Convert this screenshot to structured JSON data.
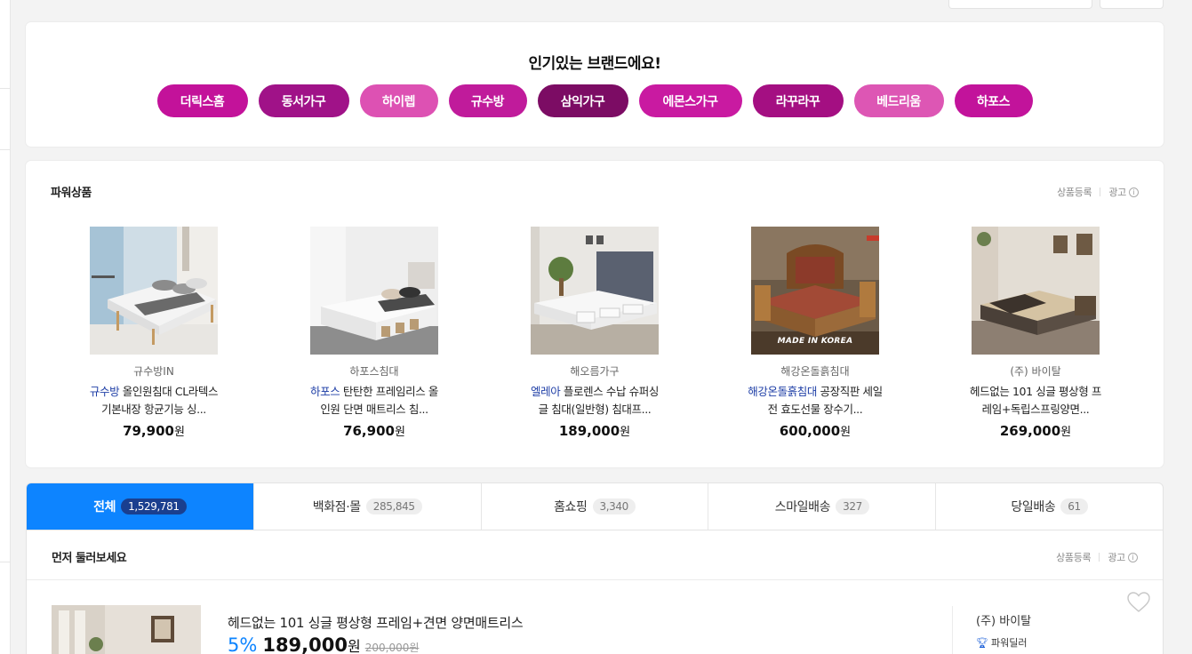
{
  "brands": {
    "title": "인기있는 브랜드에요!",
    "chips": [
      {
        "label": "더릭스홈",
        "color": "#c3129a"
      },
      {
        "label": "동서가구",
        "color": "#a01288"
      },
      {
        "label": "하이렙",
        "color": "#dd51b3"
      },
      {
        "label": "규수방",
        "color": "#c01b9b"
      },
      {
        "label": "삼익가구",
        "color": "#7c0c64"
      },
      {
        "label": "에몬스가구",
        "color": "#c91aa1"
      },
      {
        "label": "라꾸라꾸",
        "color": "#a40f82"
      },
      {
        "label": "베드리움",
        "color": "#dd56b4"
      },
      {
        "label": "하포스",
        "color": "#c2139b"
      }
    ]
  },
  "power": {
    "title": "파워상품",
    "register": "상품등록",
    "ad": "광고",
    "products": [
      {
        "mall": "규수방IN",
        "brand": "규수방",
        "name": " 올인원침대 CL라텍스 기본내장 항균기능 싱...",
        "price": "79,900",
        "won": "원"
      },
      {
        "mall": "하포스침대",
        "brand": "하포스",
        "name": " 탄탄한 프레임리스 올인원 단면 매트리스 침...",
        "price": "76,900",
        "won": "원"
      },
      {
        "mall": "해오름가구",
        "brand": "엘레아",
        "name": " 플로렌스 수납 슈퍼싱글 침대(일반형) 침대프...",
        "price": "189,000",
        "won": "원"
      },
      {
        "mall": "해강온돌흙침대",
        "brand": "해강온돌흙침대",
        "name": " 공장직판 세일전 효도선물 장수기...",
        "price": "600,000",
        "won": "원",
        "overlay": "MADE IN KOREA"
      },
      {
        "mall": "(주) 바이탈",
        "brand": "",
        "name": "헤드없는 101 싱글 평상형 프레임+독립스프링양면...",
        "price": "269,000",
        "won": "원"
      }
    ]
  },
  "tabs": [
    {
      "label": "전체",
      "count": "1,529,781"
    },
    {
      "label": "백화점·몰",
      "count": "285,845"
    },
    {
      "label": "홈쇼핑",
      "count": "3,340"
    },
    {
      "label": "스마일배송",
      "count": "327"
    },
    {
      "label": "당일배송",
      "count": "61"
    }
  ],
  "browse": {
    "title": "먼저 둘러보세요",
    "register": "상품등록",
    "ad": "광고",
    "item": {
      "title": "헤드없는 101 싱글 평상형 프레임+견면 양면매트리스",
      "discount": "5%",
      "price": "189,000",
      "won": "원",
      "original": "200,000원",
      "seller": "(주) 바이탈",
      "badge": "파워딜러"
    }
  }
}
